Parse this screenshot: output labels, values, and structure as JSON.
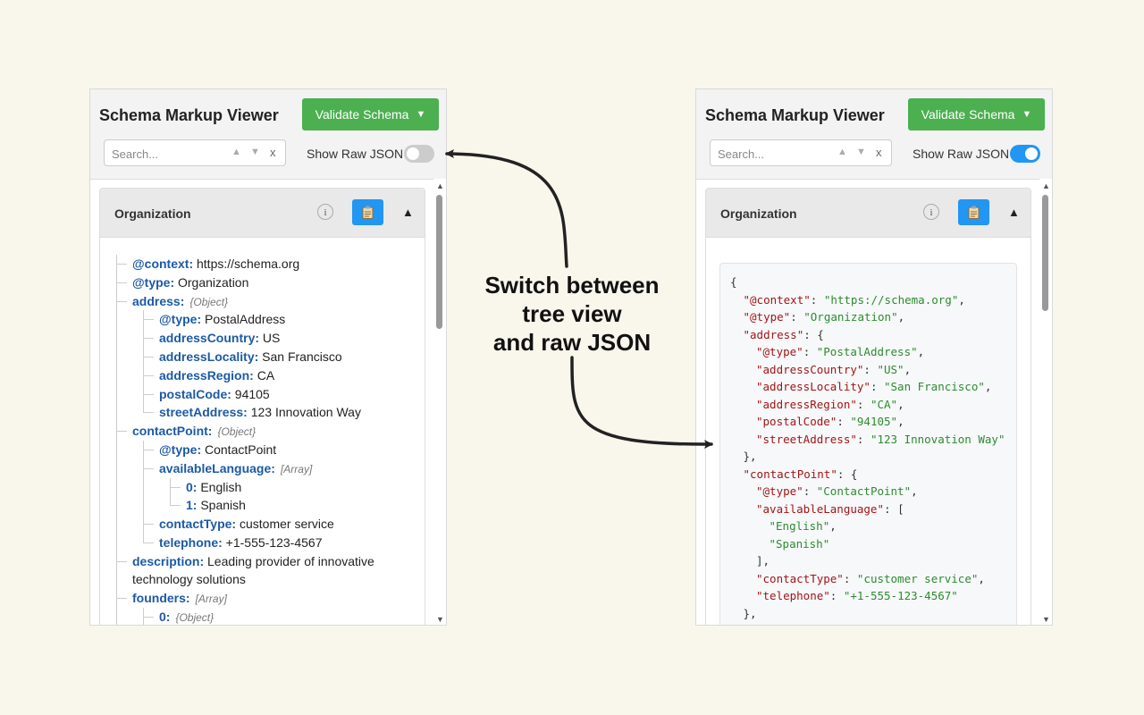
{
  "left": {
    "title": "Schema Markup Viewer",
    "validate_label": "Validate Schema",
    "search_placeholder": "Search...",
    "raw_json_label": "Show Raw JSON",
    "raw_json_on": false,
    "card_title": "Organization"
  },
  "right": {
    "title": "Schema Markup Viewer",
    "validate_label": "Validate Schema",
    "search_placeholder": "Search...",
    "raw_json_label": "Show Raw JSON",
    "raw_json_on": true,
    "card_title": "Organization"
  },
  "icons": {
    "validate_caret": "▼",
    "search_up": "▲",
    "search_down": "▼",
    "search_clear": "x",
    "info": "i",
    "collapse": "▲",
    "scroll_up": "▲",
    "scroll_down": "▼"
  },
  "colors": {
    "validate": "#4caf50",
    "toggle_on": "#2196f3",
    "copy_button": "#2196f3",
    "key": "#1c5aa6",
    "json_key": "#a31515",
    "json_string": "#2e8b2e",
    "background": "#f9f6ec"
  },
  "tree": [
    {
      "key": "@context:",
      "value": "https://schema.org",
      "depth": 0
    },
    {
      "key": "@type:",
      "value": "Organization",
      "depth": 0
    },
    {
      "key": "address:",
      "tag": "{Object}",
      "depth": 0
    },
    {
      "key": "@type:",
      "value": "PostalAddress",
      "depth": 1
    },
    {
      "key": "addressCountry:",
      "value": "US",
      "depth": 1
    },
    {
      "key": "addressLocality:",
      "value": "San Francisco",
      "depth": 1
    },
    {
      "key": "addressRegion:",
      "value": "CA",
      "depth": 1
    },
    {
      "key": "postalCode:",
      "value": "94105",
      "depth": 1
    },
    {
      "key": "streetAddress:",
      "value": "123 Innovation Way",
      "depth": 1
    },
    {
      "key": "contactPoint:",
      "tag": "{Object}",
      "depth": 0
    },
    {
      "key": "@type:",
      "value": "ContactPoint",
      "depth": 1
    },
    {
      "key": "availableLanguage:",
      "tag": "[Array]",
      "depth": 1
    },
    {
      "key": "0:",
      "value": "English",
      "depth": 2
    },
    {
      "key": "1:",
      "value": "Spanish",
      "depth": 2
    },
    {
      "key": "contactType:",
      "value": "customer service",
      "depth": 1
    },
    {
      "key": "telephone:",
      "value": "+1-555-123-4567",
      "depth": 1
    },
    {
      "key": "description:",
      "value": "Leading provider of innovative",
      "value2": "technology solutions",
      "depth": 0
    },
    {
      "key": "founders:",
      "tag": "[Array]",
      "depth": 0
    },
    {
      "key": "0:",
      "tag": "{Object}",
      "depth": 1
    }
  ],
  "raw_json": [
    {
      "indent": 0,
      "key": "",
      "value": "",
      "punct": "{"
    },
    {
      "indent": 1,
      "key": "\"@context\"",
      "value": "\"https://schema.org\"",
      "punct": ","
    },
    {
      "indent": 1,
      "key": "\"@type\"",
      "value": "\"Organization\"",
      "punct": ","
    },
    {
      "indent": 1,
      "key": "\"address\"",
      "value": "",
      "punct": "{"
    },
    {
      "indent": 2,
      "key": "\"@type\"",
      "value": "\"PostalAddress\"",
      "punct": ","
    },
    {
      "indent": 2,
      "key": "\"addressCountry\"",
      "value": "\"US\"",
      "punct": ","
    },
    {
      "indent": 2,
      "key": "\"addressLocality\"",
      "value": "\"San Francisco\"",
      "punct": ","
    },
    {
      "indent": 2,
      "key": "\"addressRegion\"",
      "value": "\"CA\"",
      "punct": ","
    },
    {
      "indent": 2,
      "key": "\"postalCode\"",
      "value": "\"94105\"",
      "punct": ","
    },
    {
      "indent": 2,
      "key": "\"streetAddress\"",
      "value": "\"123 Innovation Way\"",
      "punct": ""
    },
    {
      "indent": 1,
      "key": "",
      "value": "",
      "punct": "},"
    },
    {
      "indent": 1,
      "key": "\"contactPoint\"",
      "value": "",
      "punct": "{"
    },
    {
      "indent": 2,
      "key": "\"@type\"",
      "value": "\"ContactPoint\"",
      "punct": ","
    },
    {
      "indent": 2,
      "key": "\"availableLanguage\"",
      "value": "",
      "punct": "["
    },
    {
      "indent": 3,
      "key": "",
      "value": "\"English\"",
      "punct": ","
    },
    {
      "indent": 3,
      "key": "",
      "value": "\"Spanish\"",
      "punct": ""
    },
    {
      "indent": 2,
      "key": "",
      "value": "",
      "punct": "],"
    },
    {
      "indent": 2,
      "key": "\"contactType\"",
      "value": "\"customer service\"",
      "punct": ","
    },
    {
      "indent": 2,
      "key": "\"telephone\"",
      "value": "\"+1-555-123-4567\"",
      "punct": ""
    },
    {
      "indent": 1,
      "key": "",
      "value": "",
      "punct": "},"
    }
  ],
  "annotation": {
    "line1": "Switch between",
    "line2": "tree view",
    "line3": "and raw JSON"
  }
}
